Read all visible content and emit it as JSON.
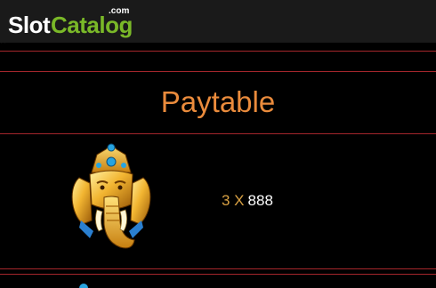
{
  "header": {
    "logo_main": "Slot",
    "logo_accent": "Catalog",
    "logo_tld": ".com"
  },
  "page": {
    "title": "Paytable"
  },
  "paytable": {
    "rows": [
      {
        "symbol": "ganesha-head-symbol",
        "count": "3 X",
        "value": "888"
      }
    ]
  },
  "colors": {
    "background": "#000000",
    "divider": "#a5262c",
    "title": "#ea8b3c",
    "count": "#d7a043",
    "value": "#ffffff",
    "logo_accent": "#7ab828"
  }
}
